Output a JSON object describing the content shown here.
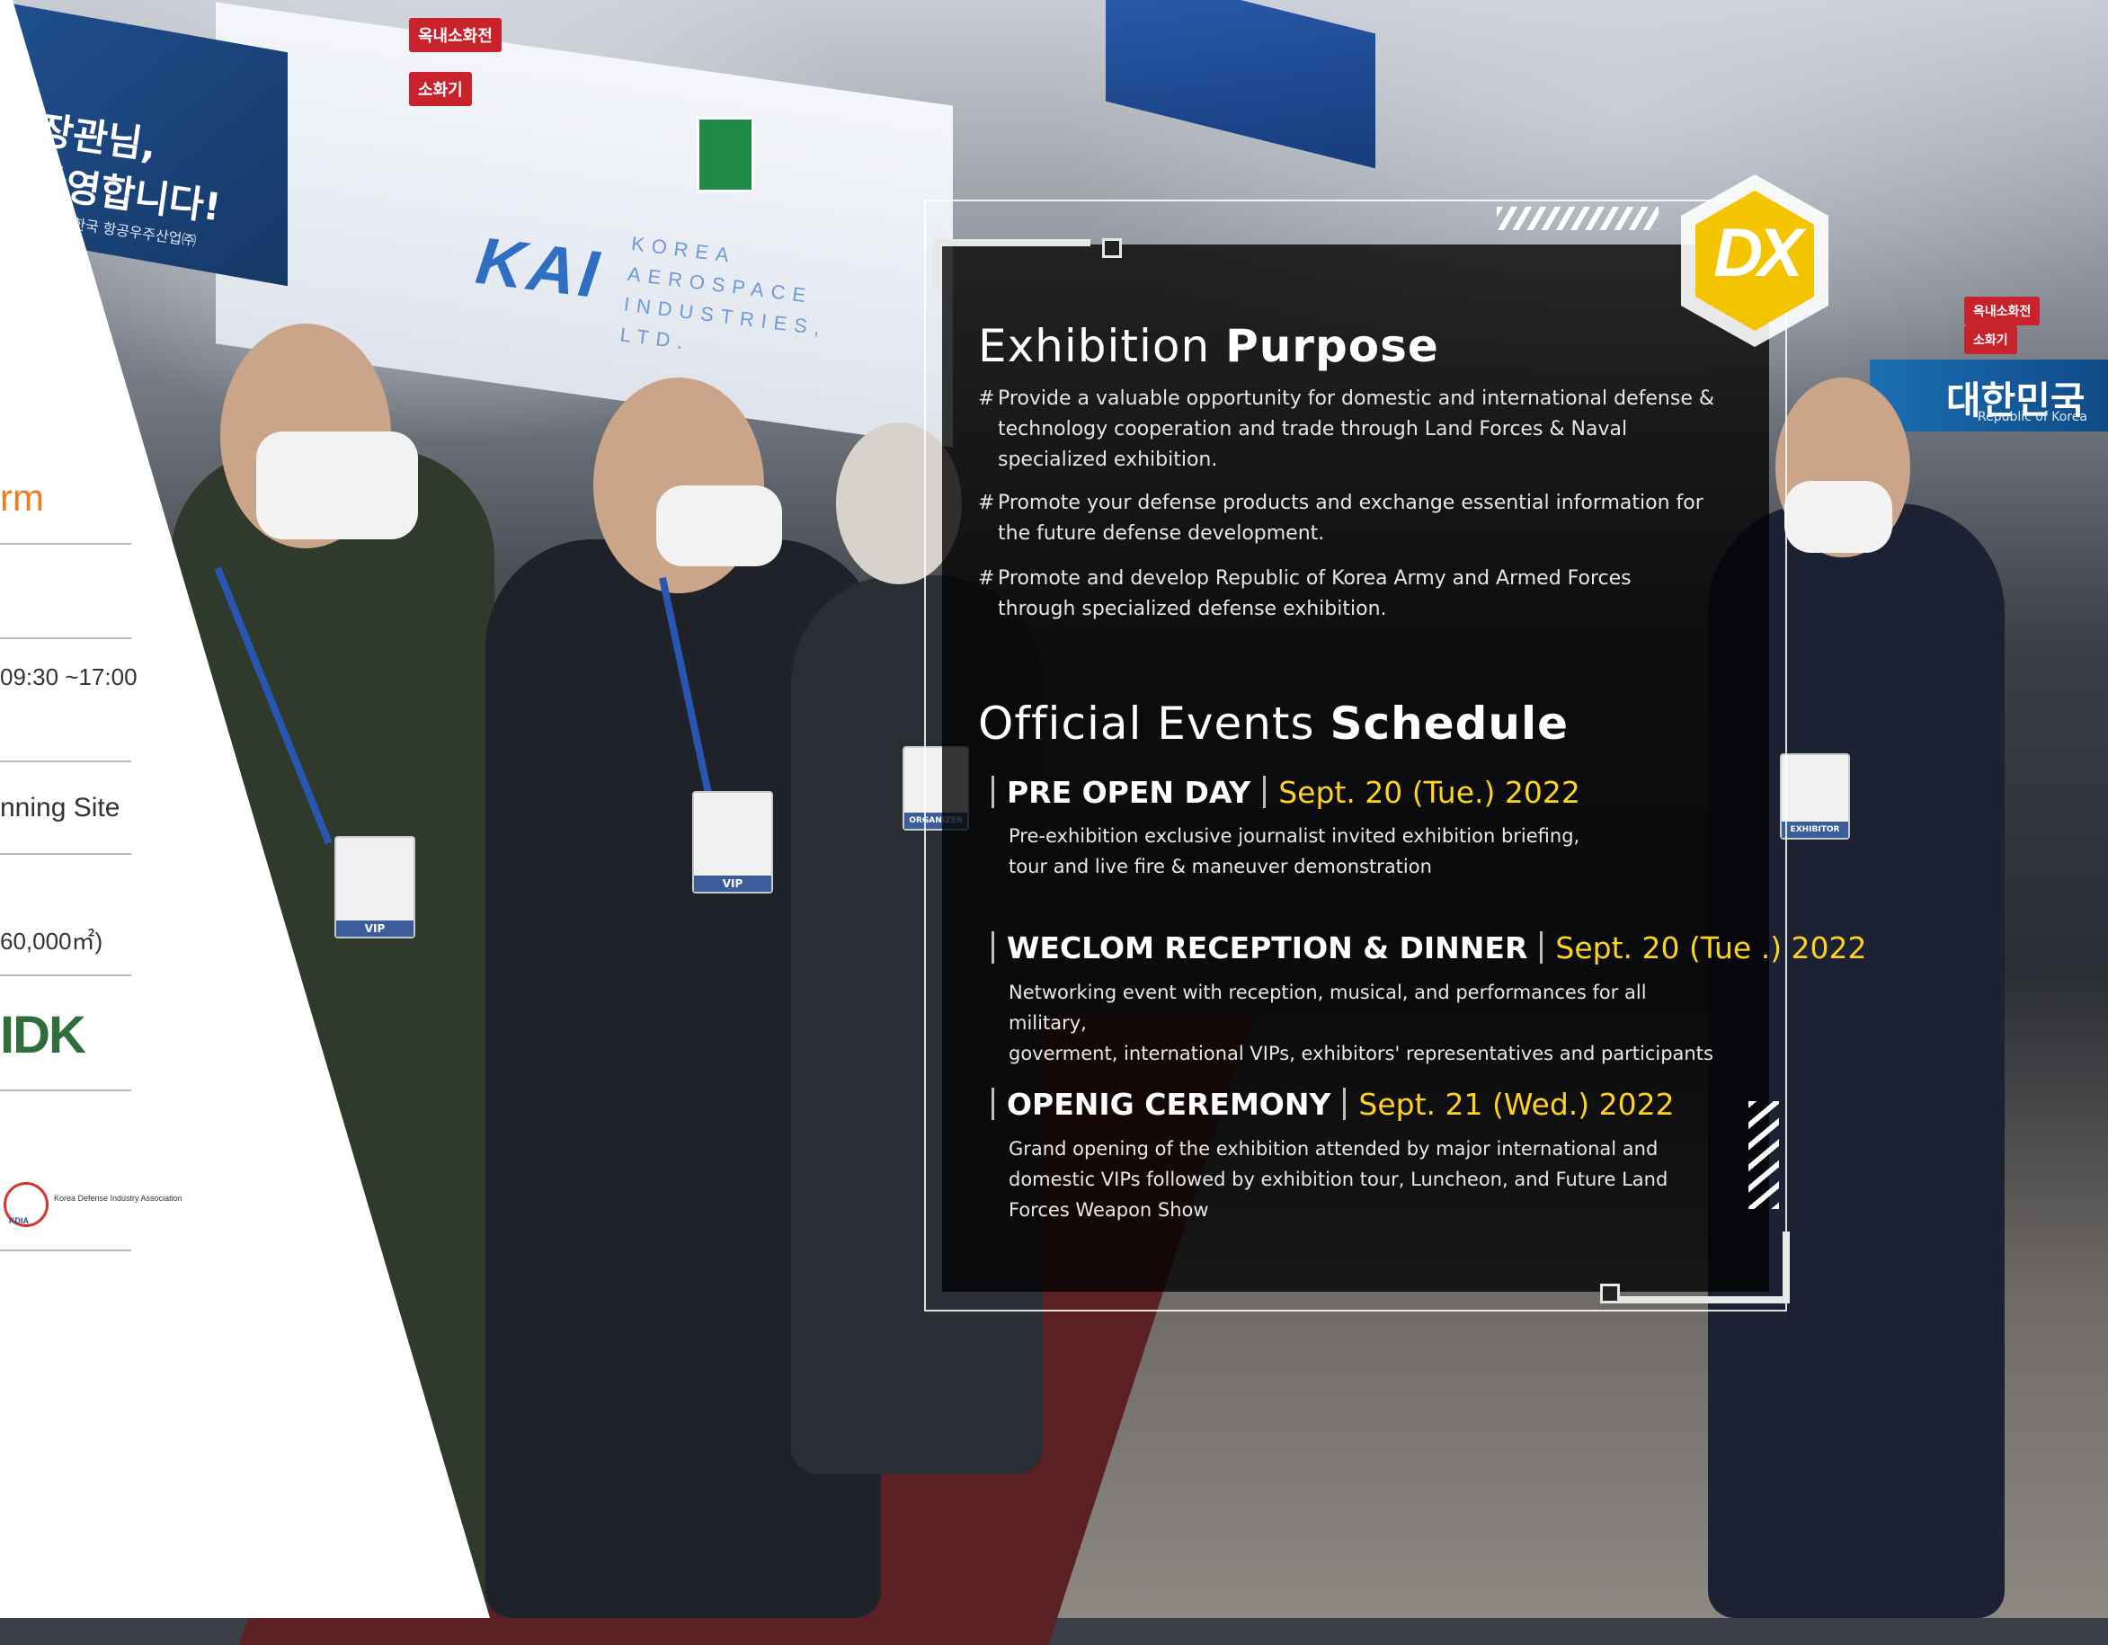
{
  "background": {
    "banner_korean": [
      "장관님,",
      "환영합니다!"
    ],
    "banner_korean_sub": "한국 항공우주산업㈜",
    "booth_logo": "KAI",
    "booth_logo_sub": "KOREA AEROSPACE INDUSTRIES, LTD.",
    "sign_hydrant": "옥내소화전",
    "sign_extinguisher": "소화기",
    "right_banner": "대한민국",
    "right_banner_sub": "Republic of Korea",
    "badges": [
      "VIP",
      "VIP",
      "ORGANIZER",
      "EXHIBITOR"
    ]
  },
  "left_panel": {
    "heading_fragment": "rm",
    "hours_fragment": "09:30 ~17:00",
    "site_fragment": "nning Site",
    "area_fragment": "60,000㎡)",
    "sponsor_logo": "IDK",
    "partner_logo_text": "Korea Defense Industry Association",
    "partner_logo_abbr": "KDIA"
  },
  "logo": {
    "text": "DX"
  },
  "purpose": {
    "title_light": "Exhibition ",
    "title_bold": "Purpose",
    "items": [
      "Provide a valuable opportunity for domestic and international defense & technology cooperation and trade through Land Forces & Naval specialized exhibition.",
      "Promote your defense products and exchange essential information for the future defense development.",
      "Promote and develop Republic of Korea Army and Armed Forces through specialized defense exhibition."
    ],
    "bullet": "#"
  },
  "schedule": {
    "title_light": "Official Events ",
    "title_bold": "Schedule",
    "events": [
      {
        "name": "PRE OPEN DAY",
        "date": "Sept. 20 (Tue.) 2022",
        "desc_lines": [
          "Pre-exhibition exclusive journalist invited exhibition briefing,",
          "tour and live fire & maneuver demonstration"
        ]
      },
      {
        "name": "WECLOM RECEPTION & DINNER",
        "date": "Sept. 20 (Tue .) 2022",
        "desc_lines": [
          "Networking event with reception, musical, and performances for all military,",
          "goverment, international VIPs, exhibitors' representatives and participants"
        ]
      },
      {
        "name": "OPENIG CEREMONY",
        "date": "Sept. 21 (Wed.) 2022",
        "desc_lines": [
          "Grand opening of the exhibition attended by major international and",
          "domestic VIPs followed by exhibition tour, Luncheon, and Future Land",
          "Forces Weapon Show"
        ]
      }
    ]
  },
  "colors": {
    "accent_orange": "#ef7f1a",
    "date_yellow": "#ffd21f",
    "logo_yellow": "#f5c400",
    "panel_bg": "rgba(0,0,0,0.78)"
  }
}
